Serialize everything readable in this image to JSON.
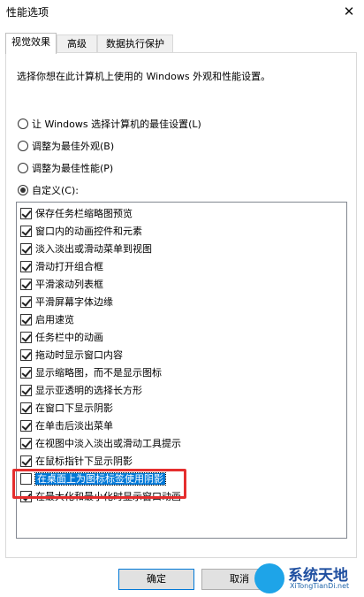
{
  "window": {
    "title": "性能选项",
    "close_glyph": "✕"
  },
  "tabs": [
    {
      "label": "视觉效果",
      "active": true
    },
    {
      "label": "高级",
      "active": false
    },
    {
      "label": "数据执行保护",
      "active": false
    }
  ],
  "description": "选择你想在此计算机上使用的 Windows 外观和性能设置。",
  "radios": [
    {
      "label": "让 Windows 选择计算机的最佳设置(L)",
      "checked": false
    },
    {
      "label": "调整为最佳外观(B)",
      "checked": false
    },
    {
      "label": "调整为最佳性能(P)",
      "checked": false
    },
    {
      "label": "自定义(C):",
      "checked": true
    }
  ],
  "effects": [
    {
      "label": "保存任务栏缩略图预览",
      "checked": true
    },
    {
      "label": "窗口内的动画控件和元素",
      "checked": true
    },
    {
      "label": "淡入淡出或滑动菜单到视图",
      "checked": true
    },
    {
      "label": "滑动打开组合框",
      "checked": true
    },
    {
      "label": "平滑滚动列表框",
      "checked": true
    },
    {
      "label": "平滑屏幕字体边缘",
      "checked": true
    },
    {
      "label": "启用速览",
      "checked": true
    },
    {
      "label": "任务栏中的动画",
      "checked": true
    },
    {
      "label": "拖动时显示窗口内容",
      "checked": true
    },
    {
      "label": "显示缩略图，而不是显示图标",
      "checked": true
    },
    {
      "label": "显示亚透明的选择长方形",
      "checked": true
    },
    {
      "label": "在窗口下显示阴影",
      "checked": true
    },
    {
      "label": "在单击后淡出菜单",
      "checked": true
    },
    {
      "label": "在视图中淡入淡出或滑动工具提示",
      "checked": true
    },
    {
      "label": "在鼠标指针下显示阴影",
      "checked": true
    },
    {
      "label": "在桌面上为图标标签使用阴影",
      "checked": false,
      "selected": true
    },
    {
      "label": "在最大化和最小化时显示窗口动画",
      "checked": true
    }
  ],
  "buttons": {
    "ok": "确定",
    "cancel": "取消"
  },
  "watermark": {
    "main": "系统天地",
    "sub": "XiTongTianDi.net"
  },
  "colors": {
    "highlight_box": "#e52e2e",
    "selection": "#0078d7"
  }
}
